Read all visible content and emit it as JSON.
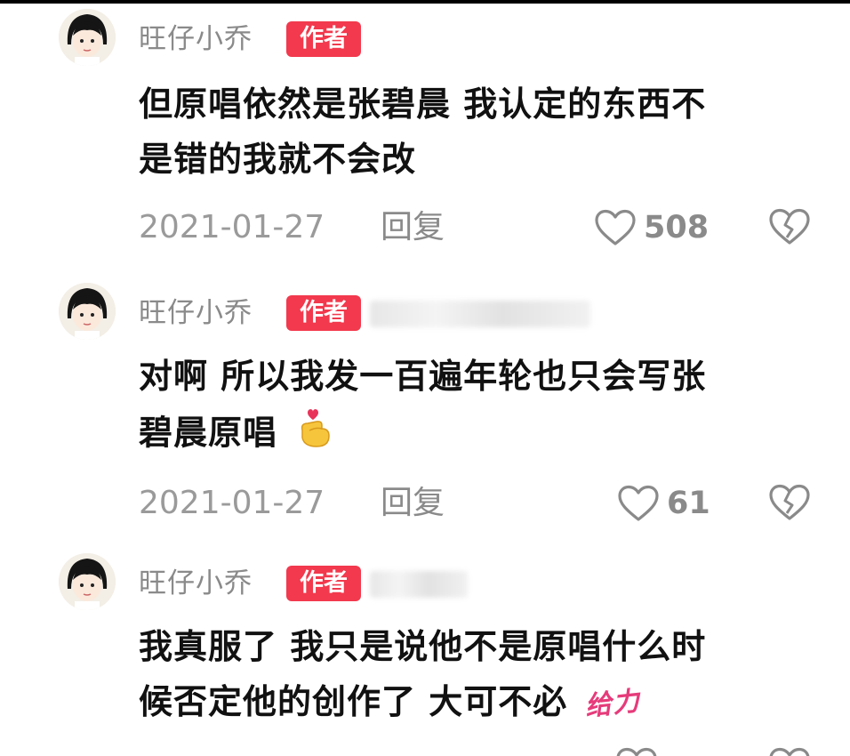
{
  "comments": [
    {
      "user": "旺仔小乔",
      "badge": "作者",
      "lines": [
        "但原唱依然是张碧晨 我认定的东西不",
        "是错的我就不会改"
      ],
      "date": "2021-01-27",
      "reply_label": "回复",
      "likes": "508"
    },
    {
      "user": "旺仔小乔",
      "badge": "作者",
      "lines": [
        "对啊 所以我发一百遍年轮也只会写张",
        "碧晨原唱"
      ],
      "date": "2021-01-27",
      "reply_label": "回复",
      "likes": "61"
    },
    {
      "user": "旺仔小乔",
      "badge": "作者",
      "lines": [
        "我真服了 我只是说他不是原唱什么时",
        "候否定他的创作了 大可不必"
      ],
      "sticker": "给力"
    }
  ],
  "icons": {
    "like": "heart-outline-icon",
    "dislike": "broken-heart-icon",
    "emoji": "finger-heart-emoji",
    "sticker": "geili-sticker"
  },
  "colors": {
    "badge": "#f2394d",
    "muted": "#8a8a8a",
    "text": "#111111"
  }
}
